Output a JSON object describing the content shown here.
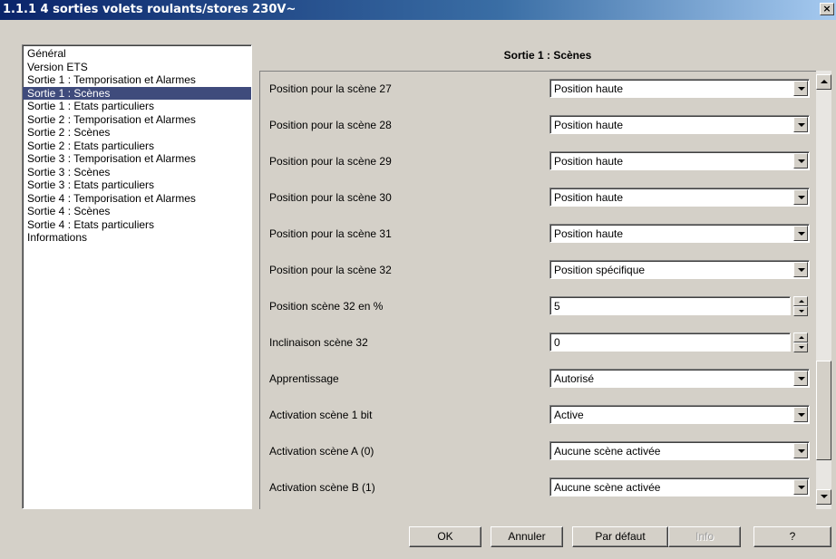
{
  "window": {
    "title": "1.1.1 4 sorties volets roulants/stores 230V~",
    "close_label": "×"
  },
  "tree": {
    "items": [
      "Général",
      "Version ETS",
      "Sortie 1 : Temporisation et Alarmes",
      "Sortie 1 : Scènes",
      "Sortie 1 : Etats particuliers",
      "Sortie 2 : Temporisation et Alarmes",
      "Sortie 2 : Scènes",
      "Sortie 2 : Etats particuliers",
      "Sortie 3 : Temporisation et Alarmes",
      "Sortie 3 : Scènes",
      "Sortie 3 : Etats particuliers",
      "Sortie 4 : Temporisation et Alarmes",
      "Sortie 4 : Scènes",
      "Sortie 4 : Etats particuliers",
      "Informations"
    ],
    "selected": "Sortie 1 : Scènes"
  },
  "section": {
    "title": "Sortie 1 : Scènes"
  },
  "params": [
    {
      "label": "Position pour la scène 27",
      "value": "Position haute"
    },
    {
      "label": "Position pour la scène 28",
      "value": "Position haute"
    },
    {
      "label": "Position pour la scène 29",
      "value": "Position haute"
    },
    {
      "label": "Position pour la scène 30",
      "value": "Position haute"
    },
    {
      "label": "Position pour la scène 31",
      "value": "Position haute"
    },
    {
      "label": "Position pour la scène 32",
      "value": "Position spécifique"
    },
    {
      "label": "Position scène 32 en %",
      "value": "5"
    },
    {
      "label": "Inclinaison scène 32",
      "value": "0"
    },
    {
      "label": "Apprentissage",
      "value": "Autorisé"
    },
    {
      "label": "Activation scène 1 bit",
      "value": "Active"
    },
    {
      "label": "Activation scène A (0)",
      "value": "Aucune scène activée"
    },
    {
      "label": "Activation scène B (1)",
      "value": "Aucune scène activée"
    }
  ],
  "buttons": {
    "ok": "OK",
    "cancel": "Annuler",
    "default": "Par défaut",
    "info": "Info",
    "help": "?"
  }
}
